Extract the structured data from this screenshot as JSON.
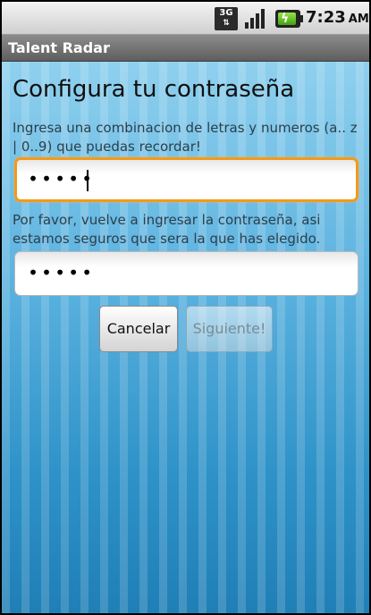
{
  "status_bar": {
    "network": "3G",
    "network_arrows": "⇅",
    "signal_icon": "signal-strength-icon",
    "battery_icon": "battery-charging-icon",
    "time": "7:23",
    "time_suffix": "AM"
  },
  "app": {
    "title": "Talent Radar"
  },
  "main": {
    "heading": "Configura tu contraseña",
    "instruction": "Ingresa una combinacion de letras y numeros (a.. z | 0..9) que puedas recordar!",
    "password_field": {
      "masked_value": "•••••"
    },
    "confirm_instruction": "Por favor, vuelve a ingresar la contraseña, asi estamos seguros que sera la que has elegido.",
    "confirm_password_field": {
      "masked_value": "•••••"
    },
    "buttons": {
      "cancel_label": "Cancelar",
      "next_label": "Siguiente!"
    }
  },
  "colors": {
    "accent_focus": "#f29a1a",
    "background_stripe": "#2e92c8"
  }
}
